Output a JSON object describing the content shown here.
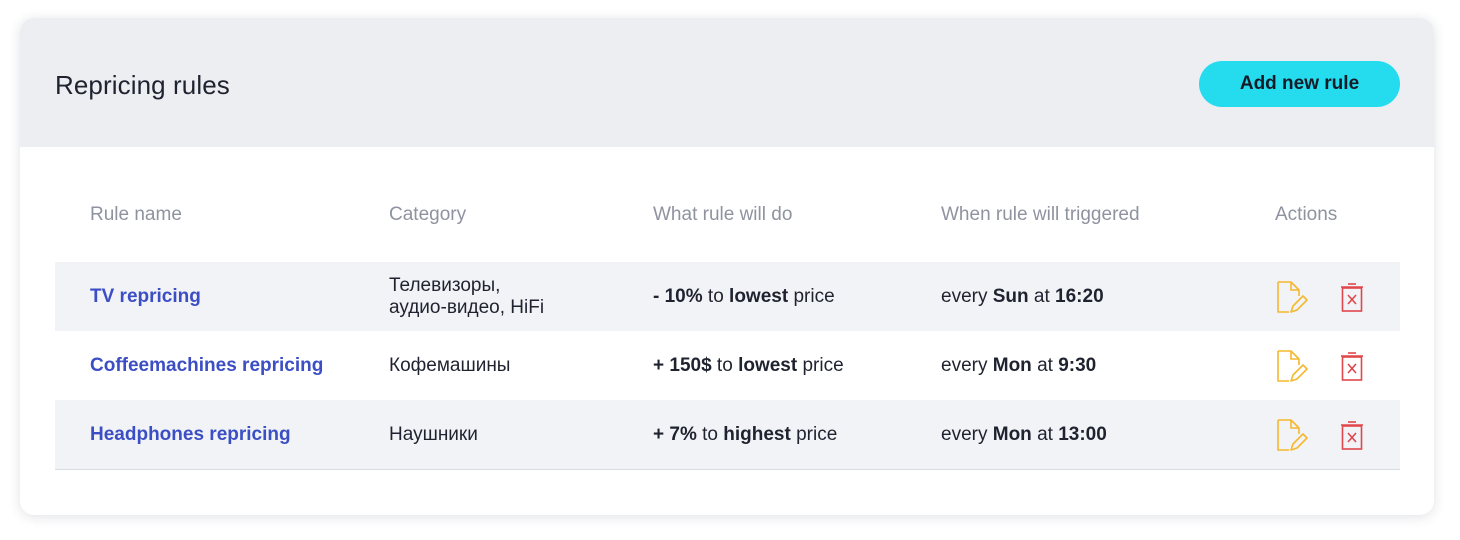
{
  "header": {
    "title": "Repricing rules",
    "add_button_label": "Add new rule"
  },
  "colors": {
    "accent": "#25dcef",
    "link": "#3b4ec4",
    "edit_icon": "#f5b82e",
    "delete_icon": "#e0474c"
  },
  "table": {
    "columns": [
      "Rule name",
      "Category",
      "What rule will do",
      "When rule will triggered",
      "Actions"
    ],
    "rows": [
      {
        "name": "TV repricing",
        "category_line1": "Телевизоры,",
        "category_line2": "аудио-видео, HiFi",
        "action": {
          "prefix": "- 10%",
          "mid": " to ",
          "target": "lowest",
          "suffix": " price"
        },
        "schedule": {
          "every": "every ",
          "day": "Sun",
          "at": " at ",
          "time": "16:20"
        },
        "edit_icon": "edit-document-icon",
        "delete_icon": "trash-icon"
      },
      {
        "name": "Coffeemachines repricing",
        "category": "Кофемашины",
        "action": {
          "prefix": "+ 150$",
          "mid": " to ",
          "target": "lowest",
          "suffix": " price"
        },
        "schedule": {
          "every": "every ",
          "day": "Mon",
          "at": " at ",
          "time": "9:30"
        },
        "edit_icon": "edit-document-icon",
        "delete_icon": "trash-icon"
      },
      {
        "name": "Headphones repricing",
        "category": "Наушники",
        "action": {
          "prefix": "+ 7%",
          "mid": " to ",
          "target": "highest",
          "suffix": " price"
        },
        "schedule": {
          "every": "every ",
          "day": "Mon",
          "at": " at ",
          "time": "13:00"
        },
        "edit_icon": "edit-document-icon",
        "delete_icon": "trash-icon"
      }
    ]
  }
}
